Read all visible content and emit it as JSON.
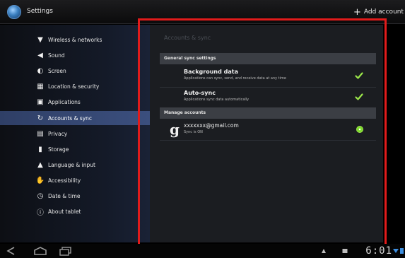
{
  "app_bar": {
    "title": "Settings",
    "add_account_label": "Add account"
  },
  "sidebar": {
    "items": [
      {
        "label": "Wireless & networks",
        "icon": "wifi-icon"
      },
      {
        "label": "Sound",
        "icon": "speaker-icon"
      },
      {
        "label": "Screen",
        "icon": "brightness-icon"
      },
      {
        "label": "Location & security",
        "icon": "grid-lock-icon"
      },
      {
        "label": "Applications",
        "icon": "applications-icon"
      },
      {
        "label": "Accounts & sync",
        "icon": "sync-icon",
        "active": true
      },
      {
        "label": "Privacy",
        "icon": "privacy-icon"
      },
      {
        "label": "Storage",
        "icon": "storage-icon"
      },
      {
        "label": "Language & input",
        "icon": "language-icon"
      },
      {
        "label": "Accessibility",
        "icon": "accessibility-icon"
      },
      {
        "label": "Date & time",
        "icon": "clock-icon"
      },
      {
        "label": "About tablet",
        "icon": "info-icon"
      }
    ]
  },
  "content": {
    "title": "Accounts & sync",
    "general_header": "General sync settings",
    "background_data": {
      "title": "Background data",
      "summary": "Applications can sync, send, and receive data at any time",
      "checked": true
    },
    "auto_sync": {
      "title": "Auto-sync",
      "summary": "Applications sync data automatically",
      "checked": true
    },
    "manage_header": "Manage accounts",
    "account": {
      "email": "xxxxxxx@gmail.com",
      "status": "Sync is ON"
    }
  },
  "system_bar": {
    "clock": "6:01"
  },
  "colors": {
    "accent_highlight": "#e11b1b",
    "check_green": "#9be64a",
    "active_item": "#3b4f7e"
  }
}
